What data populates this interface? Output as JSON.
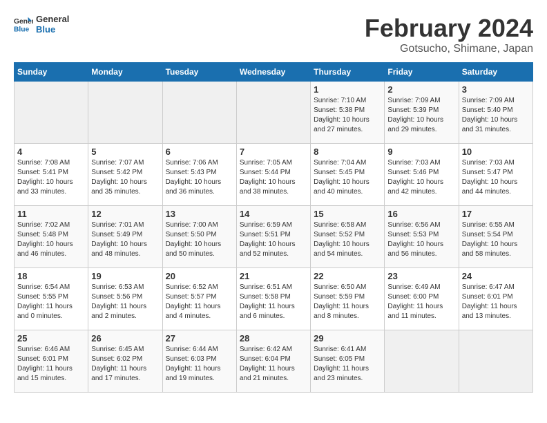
{
  "logo": {
    "line1": "General",
    "line2": "Blue"
  },
  "title": "February 2024",
  "subtitle": "Gotsucho, Shimane, Japan",
  "days_header": [
    "Sunday",
    "Monday",
    "Tuesday",
    "Wednesday",
    "Thursday",
    "Friday",
    "Saturday"
  ],
  "weeks": [
    [
      {
        "num": "",
        "info": ""
      },
      {
        "num": "",
        "info": ""
      },
      {
        "num": "",
        "info": ""
      },
      {
        "num": "",
        "info": ""
      },
      {
        "num": "1",
        "info": "Sunrise: 7:10 AM\nSunset: 5:38 PM\nDaylight: 10 hours\nand 27 minutes."
      },
      {
        "num": "2",
        "info": "Sunrise: 7:09 AM\nSunset: 5:39 PM\nDaylight: 10 hours\nand 29 minutes."
      },
      {
        "num": "3",
        "info": "Sunrise: 7:09 AM\nSunset: 5:40 PM\nDaylight: 10 hours\nand 31 minutes."
      }
    ],
    [
      {
        "num": "4",
        "info": "Sunrise: 7:08 AM\nSunset: 5:41 PM\nDaylight: 10 hours\nand 33 minutes."
      },
      {
        "num": "5",
        "info": "Sunrise: 7:07 AM\nSunset: 5:42 PM\nDaylight: 10 hours\nand 35 minutes."
      },
      {
        "num": "6",
        "info": "Sunrise: 7:06 AM\nSunset: 5:43 PM\nDaylight: 10 hours\nand 36 minutes."
      },
      {
        "num": "7",
        "info": "Sunrise: 7:05 AM\nSunset: 5:44 PM\nDaylight: 10 hours\nand 38 minutes."
      },
      {
        "num": "8",
        "info": "Sunrise: 7:04 AM\nSunset: 5:45 PM\nDaylight: 10 hours\nand 40 minutes."
      },
      {
        "num": "9",
        "info": "Sunrise: 7:03 AM\nSunset: 5:46 PM\nDaylight: 10 hours\nand 42 minutes."
      },
      {
        "num": "10",
        "info": "Sunrise: 7:03 AM\nSunset: 5:47 PM\nDaylight: 10 hours\nand 44 minutes."
      }
    ],
    [
      {
        "num": "11",
        "info": "Sunrise: 7:02 AM\nSunset: 5:48 PM\nDaylight: 10 hours\nand 46 minutes."
      },
      {
        "num": "12",
        "info": "Sunrise: 7:01 AM\nSunset: 5:49 PM\nDaylight: 10 hours\nand 48 minutes."
      },
      {
        "num": "13",
        "info": "Sunrise: 7:00 AM\nSunset: 5:50 PM\nDaylight: 10 hours\nand 50 minutes."
      },
      {
        "num": "14",
        "info": "Sunrise: 6:59 AM\nSunset: 5:51 PM\nDaylight: 10 hours\nand 52 minutes."
      },
      {
        "num": "15",
        "info": "Sunrise: 6:58 AM\nSunset: 5:52 PM\nDaylight: 10 hours\nand 54 minutes."
      },
      {
        "num": "16",
        "info": "Sunrise: 6:56 AM\nSunset: 5:53 PM\nDaylight: 10 hours\nand 56 minutes."
      },
      {
        "num": "17",
        "info": "Sunrise: 6:55 AM\nSunset: 5:54 PM\nDaylight: 10 hours\nand 58 minutes."
      }
    ],
    [
      {
        "num": "18",
        "info": "Sunrise: 6:54 AM\nSunset: 5:55 PM\nDaylight: 11 hours\nand 0 minutes."
      },
      {
        "num": "19",
        "info": "Sunrise: 6:53 AM\nSunset: 5:56 PM\nDaylight: 11 hours\nand 2 minutes."
      },
      {
        "num": "20",
        "info": "Sunrise: 6:52 AM\nSunset: 5:57 PM\nDaylight: 11 hours\nand 4 minutes."
      },
      {
        "num": "21",
        "info": "Sunrise: 6:51 AM\nSunset: 5:58 PM\nDaylight: 11 hours\nand 6 minutes."
      },
      {
        "num": "22",
        "info": "Sunrise: 6:50 AM\nSunset: 5:59 PM\nDaylight: 11 hours\nand 8 minutes."
      },
      {
        "num": "23",
        "info": "Sunrise: 6:49 AM\nSunset: 6:00 PM\nDaylight: 11 hours\nand 11 minutes."
      },
      {
        "num": "24",
        "info": "Sunrise: 6:47 AM\nSunset: 6:01 PM\nDaylight: 11 hours\nand 13 minutes."
      }
    ],
    [
      {
        "num": "25",
        "info": "Sunrise: 6:46 AM\nSunset: 6:01 PM\nDaylight: 11 hours\nand 15 minutes."
      },
      {
        "num": "26",
        "info": "Sunrise: 6:45 AM\nSunset: 6:02 PM\nDaylight: 11 hours\nand 17 minutes."
      },
      {
        "num": "27",
        "info": "Sunrise: 6:44 AM\nSunset: 6:03 PM\nDaylight: 11 hours\nand 19 minutes."
      },
      {
        "num": "28",
        "info": "Sunrise: 6:42 AM\nSunset: 6:04 PM\nDaylight: 11 hours\nand 21 minutes."
      },
      {
        "num": "29",
        "info": "Sunrise: 6:41 AM\nSunset: 6:05 PM\nDaylight: 11 hours\nand 23 minutes."
      },
      {
        "num": "",
        "info": ""
      },
      {
        "num": "",
        "info": ""
      }
    ]
  ]
}
